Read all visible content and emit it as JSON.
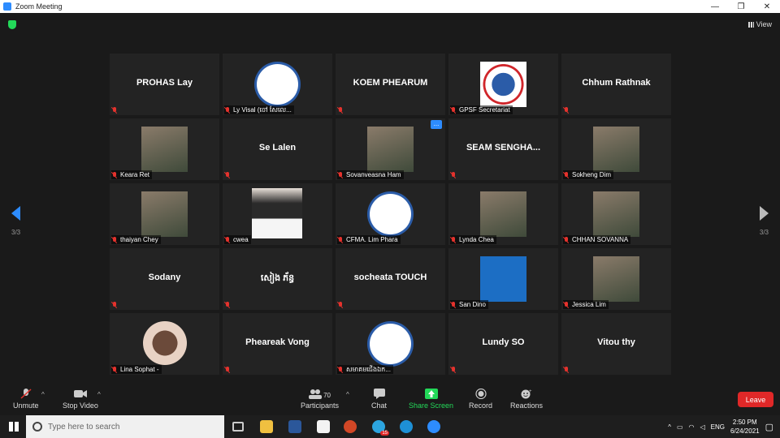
{
  "window": {
    "title": "Zoom Meeting"
  },
  "window_controls": {
    "minimize": "—",
    "maximize": "❐",
    "close": "✕"
  },
  "view_label": "View",
  "page_indicator": {
    "left": "3/3",
    "right": "3/3"
  },
  "tiles": [
    {
      "name": "PROHAS Lay",
      "label": "",
      "type": "text"
    },
    {
      "name": "",
      "label": "Ly Visal (ចៅ សែលេ...",
      "type": "logo"
    },
    {
      "name": "KOEM PHEARUM",
      "label": "",
      "type": "text"
    },
    {
      "name": "",
      "label": "GPSF Secretariat",
      "type": "map"
    },
    {
      "name": "Chhum Rathnak",
      "label": "",
      "type": "text"
    },
    {
      "name": "",
      "label": "Keara Ret",
      "type": "photo"
    },
    {
      "name": "Se Lalen",
      "label": "",
      "type": "text"
    },
    {
      "name": "",
      "label": "Sovanveasna Ham",
      "type": "photo",
      "more": "..."
    },
    {
      "name": "SEAM SENGHA...",
      "label": "",
      "type": "text"
    },
    {
      "name": "",
      "label": "Sokheng Dim",
      "type": "photo"
    },
    {
      "name": "",
      "label": "thaiyan Chey",
      "type": "photo"
    },
    {
      "name": "",
      "label": "cwea",
      "type": "vaccinated"
    },
    {
      "name": "",
      "label": "CFMA. Lim Phara",
      "type": "logo2"
    },
    {
      "name": "",
      "label": "Lynda Chea",
      "type": "photo"
    },
    {
      "name": "",
      "label": "CHHAN SOVANNA",
      "type": "photo"
    },
    {
      "name": "Sodany",
      "label": "",
      "type": "text"
    },
    {
      "name": "សៀង ភ័ន្ធ",
      "label": "",
      "type": "text"
    },
    {
      "name": "socheata TOUCH",
      "label": "",
      "type": "text"
    },
    {
      "name": "",
      "label": "San Dino",
      "type": "screen"
    },
    {
      "name": "",
      "label": "Jessica Lim",
      "type": "photo"
    },
    {
      "name": "",
      "label": "Lina Sophat -",
      "type": "round"
    },
    {
      "name": "Phea­reak Vong",
      "label": "",
      "type": "text"
    },
    {
      "name": "",
      "label": "សមាគមជើងឯក...",
      "type": "logo"
    },
    {
      "name": "Lundy SO",
      "label": "",
      "type": "text"
    },
    {
      "name": "Vitou thy",
      "label": "",
      "type": "text"
    }
  ],
  "toolbar": {
    "unmute": "Unmute",
    "stop_video": "Stop Video",
    "participants": "Participants",
    "participants_count": "70",
    "chat": "Chat",
    "share_screen": "Share Screen",
    "record": "Record",
    "reactions": "Reactions",
    "leave": "Leave"
  },
  "taskbar": {
    "search_placeholder": "Type here to search",
    "lang": "ENG",
    "time": "2:50 PM",
    "date": "6/24/2021",
    "telegram_badge": "15"
  },
  "colors": {
    "accent": "#2d8cff",
    "leave": "#e02828",
    "share": "#23d959",
    "muted": "#e5322d"
  }
}
